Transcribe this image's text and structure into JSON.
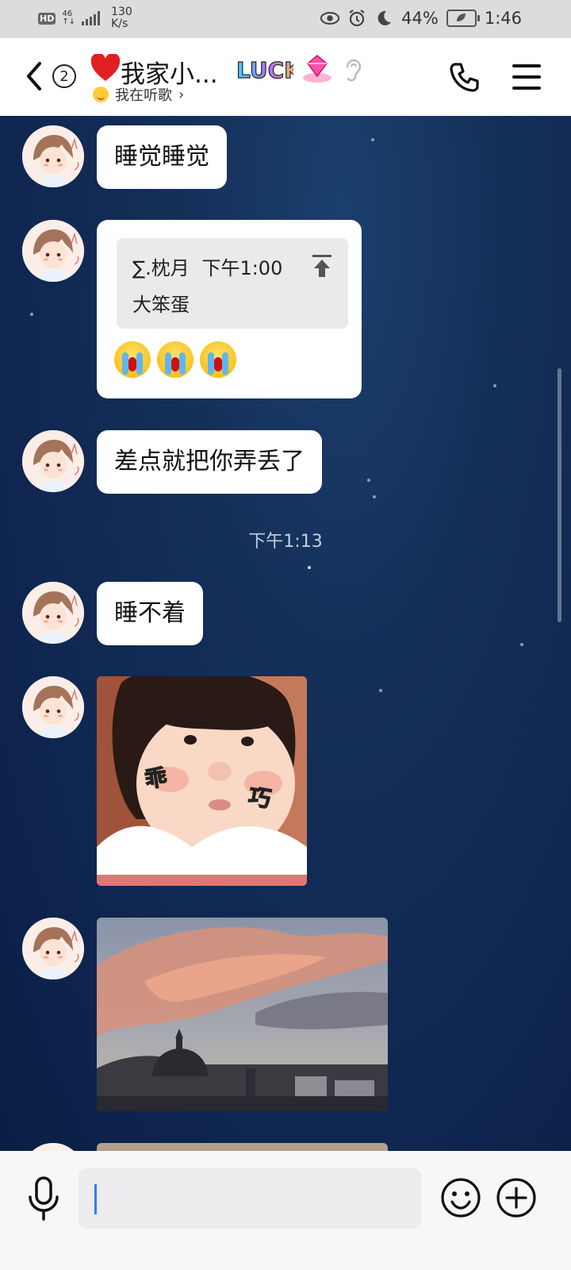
{
  "status_bar": {
    "hd": "HD",
    "net_top": "46",
    "net_bottom": "↑↓",
    "speed_value": "130",
    "speed_unit": "K/s",
    "battery_percent": "44%",
    "time": "1:46"
  },
  "header": {
    "unread_count": "2",
    "title": "我家小...",
    "status_text": "我在听歌",
    "status_chevron": "›",
    "luck_badge": "LUCK"
  },
  "messages": [
    {
      "type": "text",
      "text": "睡觉睡觉"
    },
    {
      "type": "reply",
      "quote_author": "∑.枕月",
      "quote_time": "下午1:00",
      "quote_text": "大笨蛋",
      "emoji": [
        "crying-face",
        "crying-face",
        "crying-face"
      ]
    },
    {
      "type": "text",
      "text": "差点就把你弄丢了"
    },
    {
      "type": "timestamp",
      "text": "下午1:13"
    },
    {
      "type": "text",
      "text": "睡不着"
    },
    {
      "type": "sticker",
      "caption_left": "乖",
      "caption_right": "巧"
    },
    {
      "type": "photo",
      "subject": "sunset-clouds-over-city"
    }
  ],
  "input": {
    "placeholder": ""
  },
  "colors": {
    "header_bg": "#ffffff",
    "chat_bg": "#142f58",
    "bubble_bg": "#ffffff",
    "caret": "#2b7bf6"
  }
}
